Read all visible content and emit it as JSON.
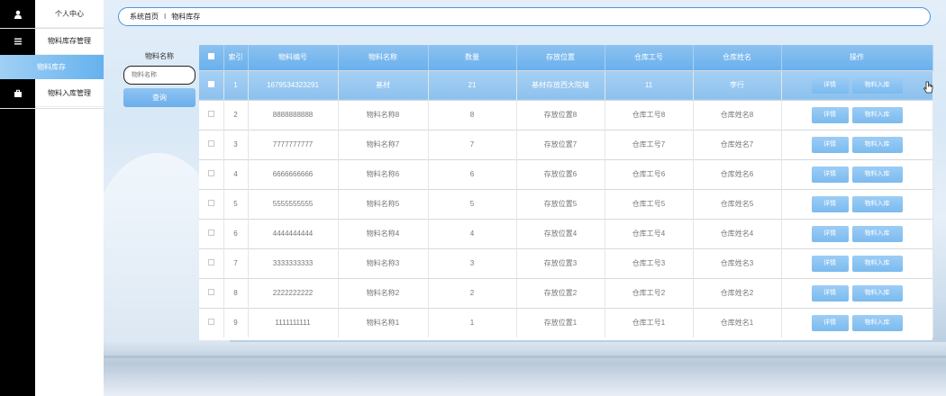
{
  "sidebar": {
    "items": [
      {
        "label": "个人中心",
        "icon": "user-icon"
      },
      {
        "label": "物料库存管理",
        "icon": "menu-icon"
      },
      {
        "label": "物料库存",
        "icon": "",
        "active": true
      },
      {
        "label": "物料入库管理",
        "icon": "briefcase-icon"
      }
    ]
  },
  "breadcrumb": {
    "home": "系统首页",
    "separator": "I",
    "current": "物料库存"
  },
  "search": {
    "label": "物料名称",
    "placeholder": "物料名称",
    "button_label": "查询"
  },
  "table": {
    "columns": [
      "索引",
      "物料编号",
      "物料名称",
      "数量",
      "存放位置",
      "仓库工号",
      "仓库姓名",
      "操作"
    ],
    "rows": [
      {
        "index": "1",
        "code": "1679534323291",
        "name": "基材",
        "qty": "21",
        "location": "基材存放西大院墙",
        "worker_id": "11",
        "worker_name": "李行",
        "highlight": true
      },
      {
        "index": "2",
        "code": "8888888888",
        "name": "物料名称8",
        "qty": "8",
        "location": "存放位置8",
        "worker_id": "仓库工号8",
        "worker_name": "仓库姓名8"
      },
      {
        "index": "3",
        "code": "7777777777",
        "name": "物料名称7",
        "qty": "7",
        "location": "存放位置7",
        "worker_id": "仓库工号7",
        "worker_name": "仓库姓名7"
      },
      {
        "index": "4",
        "code": "6666666666",
        "name": "物料名称6",
        "qty": "6",
        "location": "存放位置6",
        "worker_id": "仓库工号6",
        "worker_name": "仓库姓名6"
      },
      {
        "index": "5",
        "code": "5555555555",
        "name": "物料名称5",
        "qty": "5",
        "location": "存放位置5",
        "worker_id": "仓库工号5",
        "worker_name": "仓库姓名5"
      },
      {
        "index": "6",
        "code": "4444444444",
        "name": "物料名称4",
        "qty": "4",
        "location": "存放位置4",
        "worker_id": "仓库工号4",
        "worker_name": "仓库姓名4"
      },
      {
        "index": "7",
        "code": "3333333333",
        "name": "物料名称3",
        "qty": "3",
        "location": "存放位置3",
        "worker_id": "仓库工号3",
        "worker_name": "仓库姓名3"
      },
      {
        "index": "8",
        "code": "2222222222",
        "name": "物料名称2",
        "qty": "2",
        "location": "存放位置2",
        "worker_id": "仓库工号2",
        "worker_name": "仓库姓名2"
      },
      {
        "index": "9",
        "code": "1111111111",
        "name": "物料名称1",
        "qty": "1",
        "location": "存放位置1",
        "worker_id": "仓库工号1",
        "worker_name": "仓库姓名1"
      }
    ],
    "actions": {
      "detail": "详情",
      "stock_in": "物料入库"
    }
  },
  "colors": {
    "accent": "#6ab0ec",
    "sidebar_bg": "#000000",
    "breadcrumb_border": "#4f93d8"
  }
}
